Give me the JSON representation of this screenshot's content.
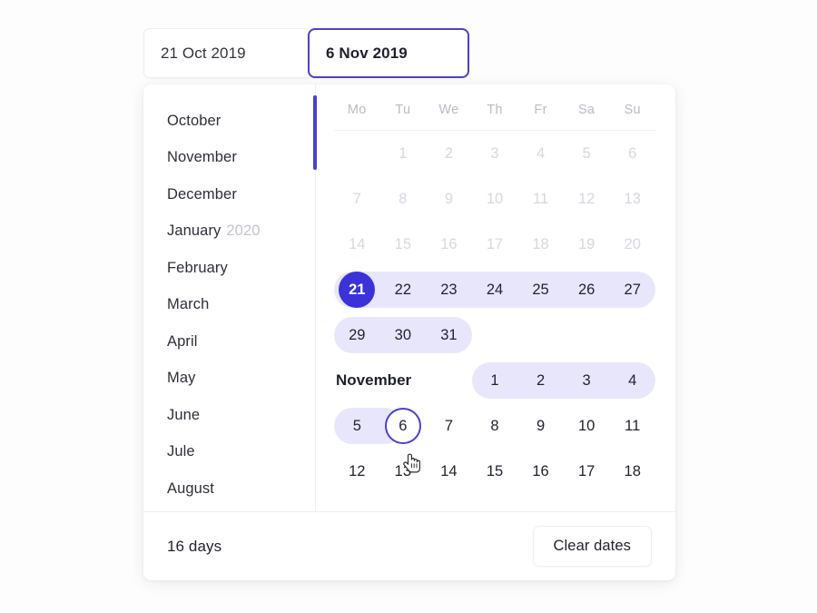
{
  "fields": {
    "start": {
      "value": "21 Oct 2019",
      "name": "start-date"
    },
    "end": {
      "value": "6 Nov 2019",
      "name": "end-date"
    }
  },
  "months": [
    {
      "label": "October",
      "year": ""
    },
    {
      "label": "November",
      "year": ""
    },
    {
      "label": "December",
      "year": ""
    },
    {
      "label": "January",
      "year": "2020"
    },
    {
      "label": "February",
      "year": ""
    },
    {
      "label": "March",
      "year": ""
    },
    {
      "label": "April",
      "year": ""
    },
    {
      "label": "May",
      "year": ""
    },
    {
      "label": "June",
      "year": ""
    },
    {
      "label": "Jule",
      "year": ""
    },
    {
      "label": "August",
      "year": ""
    }
  ],
  "weekdays": [
    "Mo",
    "Tu",
    "We",
    "Th",
    "Fr",
    "Sa",
    "Su"
  ],
  "calendar": {
    "october": {
      "rows": [
        [
          "",
          "1",
          "2",
          "3",
          "4",
          "5",
          "6"
        ],
        [
          "7",
          "8",
          "9",
          "10",
          "11",
          "12",
          "13"
        ],
        [
          "14",
          "15",
          "16",
          "17",
          "18",
          "19",
          "20"
        ],
        [
          "21",
          "22",
          "23",
          "24",
          "25",
          "26",
          "27"
        ],
        [
          "29",
          "30",
          "31",
          "",
          "",
          "",
          ""
        ]
      ]
    },
    "november": {
      "label": "November",
      "row_first": [
        "1",
        "2",
        "3",
        "4"
      ],
      "row_second": [
        "5",
        "6",
        "7",
        "8",
        "9",
        "10",
        "11"
      ],
      "row_third": [
        "12",
        "13",
        "14",
        "15",
        "16",
        "17",
        "18"
      ]
    },
    "selected_day": "21",
    "hovered_day": "6"
  },
  "footer": {
    "days_count": "16 days",
    "clear_label": "Clear dates"
  },
  "colors": {
    "accent": "#4b40cf",
    "selected_fill": "#3b32d8",
    "range_band": "#e8e6fb",
    "muted_text": "#d6d8e0"
  }
}
